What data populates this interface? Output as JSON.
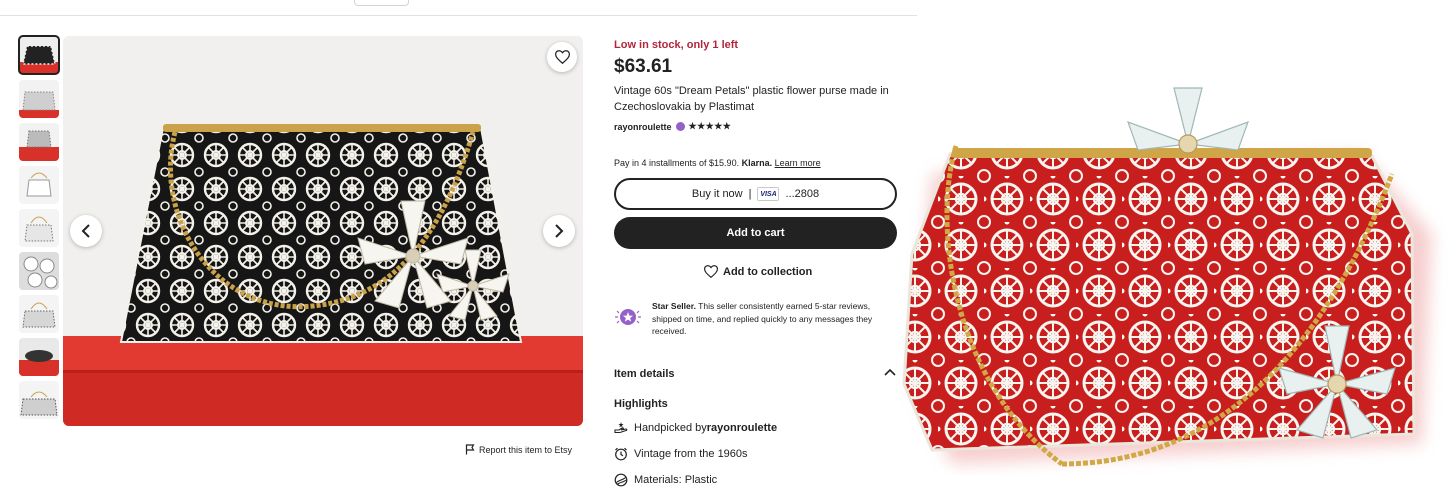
{
  "listing": {
    "stock_notice": "Low in stock, only 1 left",
    "price": "$63.61",
    "title": "Vintage 60s \"Dream Petals\" plastic flower purse made in Czechoslovakia by Plastimat",
    "shop_name": "rayonroulette",
    "stars": "★★★★★",
    "rating": 5
  },
  "payment": {
    "installments_text": "Pay in 4 installments of $15.90.",
    "klarna_label": "Klarna.",
    "learn_more": "Learn more",
    "buy_now_label": "Buy it now",
    "separator": "|",
    "card_brand": "VISA",
    "card_last4": "...2808",
    "add_to_cart_label": "Add to cart",
    "add_to_collection_label": "Add to collection"
  },
  "star_seller": {
    "title": "Star Seller.",
    "description": " This seller consistently earned 5-star reviews, shipped on time, and replied quickly to any messages they received."
  },
  "details": {
    "item_details_label": "Item details",
    "highlights_label": "Highlights",
    "handpicked_prefix": "Handpicked by ",
    "handpicked_shop": "rayonroulette",
    "vintage_text": "Vintage from the 1960s",
    "materials_text": "Materials: Plastic"
  },
  "gallery": {
    "report_label": "Report this item to Etsy",
    "thumbnail_count": 9,
    "active_index": 0
  },
  "colors": {
    "stock_red": "#b1263b",
    "button_dark": "#222222",
    "star_seller_purple": "#9560c8",
    "shelf_red": "#d8312a",
    "purse_lining_red": "#c81e1e"
  },
  "icons": [
    "heart-icon",
    "chevron-left-icon",
    "chevron-right-icon",
    "flag-icon",
    "star-seller-icon",
    "chevron-up-icon",
    "hand-icon",
    "clock-icon",
    "materials-icon"
  ]
}
